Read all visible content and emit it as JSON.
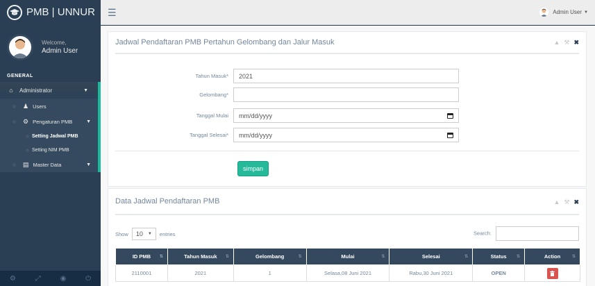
{
  "app": {
    "brand": "PMB | UNNUR"
  },
  "profile": {
    "welcome": "Welcome,",
    "name": "Admin User"
  },
  "sidebar": {
    "section": "GENERAL",
    "administrator": "Administrator",
    "users": "Users",
    "pengaturan": "Pengaturan PMB",
    "setting_jadwal": "Setting Jadwal PMB",
    "setting_nim": "Setting NIM PMB",
    "master_data": "Master Data"
  },
  "topnav": {
    "user": "Admin User"
  },
  "form_panel": {
    "title": "Jadwal Pendaftaran PMB Pertahun Gelombang dan Jalur Masuk",
    "tahun_label": "Tahun Masuk*",
    "tahun_value": "2021",
    "gelombang_label": "Gelombang*",
    "gelombang_value": "",
    "mulai_label": "Tanggal Mulai",
    "mulai_placeholder": "mm/dd/yyyy",
    "selesai_label": "Tanggal Selesai*",
    "selesai_placeholder": "mm/dd/yyyy",
    "save_label": "simpan"
  },
  "table_panel": {
    "title": "Data Jadwal Pendaftaran PMB",
    "show_label": "Show",
    "length_value": "10",
    "entries_label": "entries",
    "search_label": "Search:",
    "columns": [
      "ID PMB",
      "Tahun Masuk",
      "Gelombang",
      "Mulai",
      "Selesai",
      "Status",
      "Action"
    ],
    "rows": [
      {
        "id": "2110001",
        "tahun": "2021",
        "gelombang": "1",
        "mulai": "Selasa,08 Juni 2021",
        "selesai": "Rabu,30 Juni 2021",
        "status": "OPEN"
      }
    ]
  },
  "colors": {
    "sidebar": "#2a3f54",
    "accent": "#1abb9c",
    "save": "#26b99a",
    "delete": "#d9534f"
  }
}
